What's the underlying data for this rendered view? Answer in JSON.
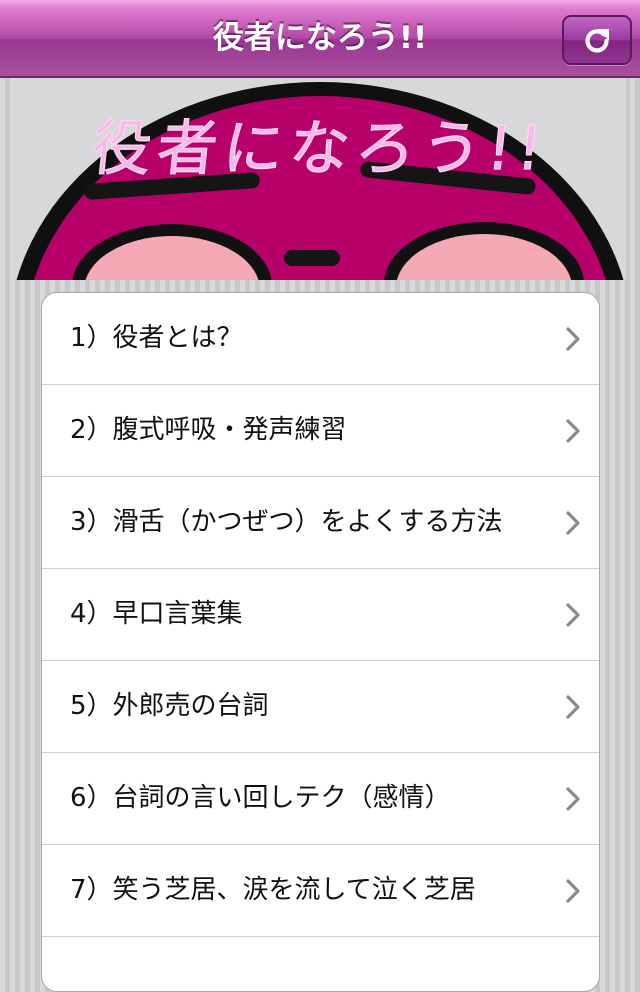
{
  "navbar": {
    "title": "役者になろう!!",
    "refresh_icon": "refresh-icon"
  },
  "banner": {
    "title": "役者になろう!!",
    "face_color": "#b8006a",
    "cheek_color": "#f5a9b4"
  },
  "menu": {
    "chevron_icon": "chevron-right-icon",
    "items": [
      {
        "label": "1）役者とは？"
      },
      {
        "label": "2）腹式呼吸・発声練習"
      },
      {
        "label": "3）滑舌（かつぜつ）をよくする方法"
      },
      {
        "label": "4）早口言葉集"
      },
      {
        "label": "5）外郎売の台詞"
      },
      {
        "label": "6）台詞の言い回しテク（感情）"
      },
      {
        "label": "7）笑う芝居、涙を流して泣く芝居"
      },
      {
        "label": ""
      }
    ]
  }
}
